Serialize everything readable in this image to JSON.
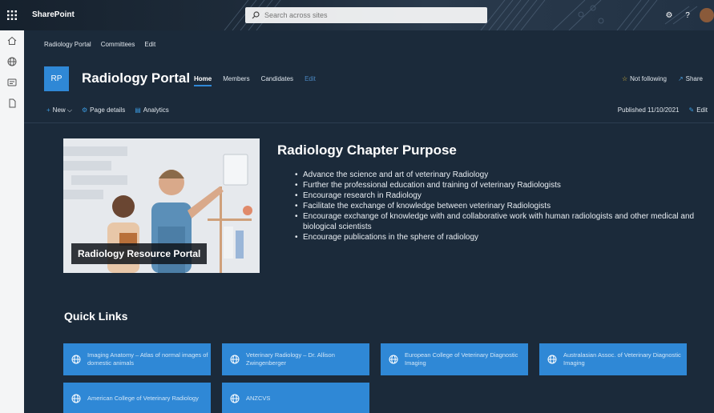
{
  "suite": {
    "brand": "SharePoint",
    "search_placeholder": "Search across sites"
  },
  "hubnav": {
    "items": [
      "Radiology Portal",
      "Committees",
      "Edit"
    ]
  },
  "site": {
    "logo": "RP",
    "title": "Radiology Portal",
    "nav": [
      "Home",
      "Members",
      "Candidates",
      "Edit"
    ],
    "follow": "Not following",
    "share": "Share"
  },
  "command": {
    "new": "New",
    "page_details": "Page details",
    "analytics": "Analytics",
    "published": "Published 11/10/2021",
    "edit": "Edit"
  },
  "hero": {
    "caption": "Radiology Resource Portal"
  },
  "purpose": {
    "title": "Radiology Chapter Purpose",
    "items": [
      "Advance the science and art of veterinary Radiology",
      "Further the professional education and training of veterinary Radiologists",
      "Encourage research in Radiology",
      "Facilitate the exchange of knowledge between veterinary Radiologists",
      "Encourage exchange of knowledge with and collaborative work with human radiologists and other medical and biological scientists",
      "Encourage publications in the sphere of radiology"
    ]
  },
  "quick_links": {
    "title": "Quick Links",
    "links": [
      "Imaging Anatomy – Atlas of normal images of domestic animals",
      "Veterinary Radiology – Dr. Allison Zwingenberger",
      "European College of Veterinary Diagnostic Imaging",
      "Australasian Assoc. of Veterinary Diagnostic Imaging",
      "American College of Veterinary Radiology",
      "ANZCVS"
    ]
  },
  "colors": {
    "accent": "#2f88d6",
    "background": "#1b2a3a"
  }
}
